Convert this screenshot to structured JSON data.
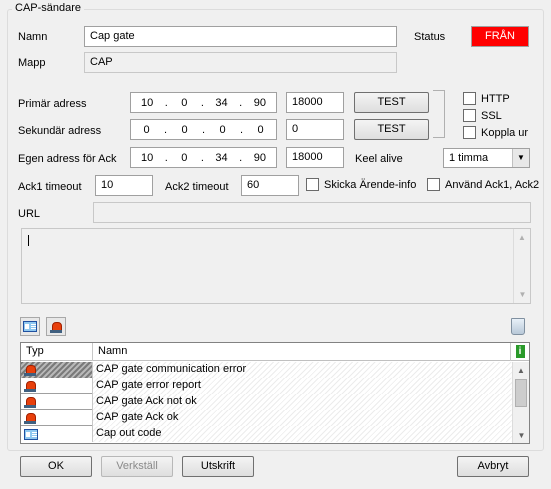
{
  "group_title": "CAP-sändare",
  "labels": {
    "name": "Namn",
    "folder": "Mapp",
    "status": "Status",
    "primary": "Primär adress",
    "secondary": "Sekundär adress",
    "own": "Egen adress för Ack",
    "keep_alive": "Keel alive",
    "ack1_timeout": "Ack1 timeout",
    "ack2_timeout": "Ack2 timeout",
    "url": "URL"
  },
  "values": {
    "name": "Cap gate",
    "folder": "CAP",
    "status": "FRÅN",
    "primary_ip": [
      "10",
      "0",
      "34",
      "90"
    ],
    "primary_port": "18000",
    "secondary_ip": [
      "0",
      "0",
      "0",
      "0"
    ],
    "secondary_port": "0",
    "own_ip": [
      "10",
      "0",
      "34",
      "90"
    ],
    "own_port": "18000",
    "keep_alive": "1 timma",
    "ack1_timeout": "10",
    "ack2_timeout": "60",
    "url": "",
    "message": ""
  },
  "buttons": {
    "test": "TEST",
    "ok": "OK",
    "apply": "Verkställ",
    "print": "Utskrift",
    "cancel": "Avbryt"
  },
  "checkboxes": {
    "http": "HTTP",
    "ssl": "SSL",
    "disconnect": "Koppla ur",
    "send_info": "Skicka Ärende-info",
    "use_ack": "Använd Ack1, Ack2"
  },
  "table": {
    "headers": [
      "Typ",
      "Namn"
    ],
    "rows": [
      {
        "icon": "siren-icon",
        "name": "CAP gate communication error"
      },
      {
        "icon": "siren-icon",
        "name": "CAP gate error report"
      },
      {
        "icon": "siren-icon",
        "name": "CAP gate Ack not ok"
      },
      {
        "icon": "siren-icon",
        "name": "CAP gate Ack ok"
      },
      {
        "icon": "card-icon",
        "name": "Cap out code"
      }
    ]
  },
  "colors": {
    "status_off": "#ff0000"
  }
}
